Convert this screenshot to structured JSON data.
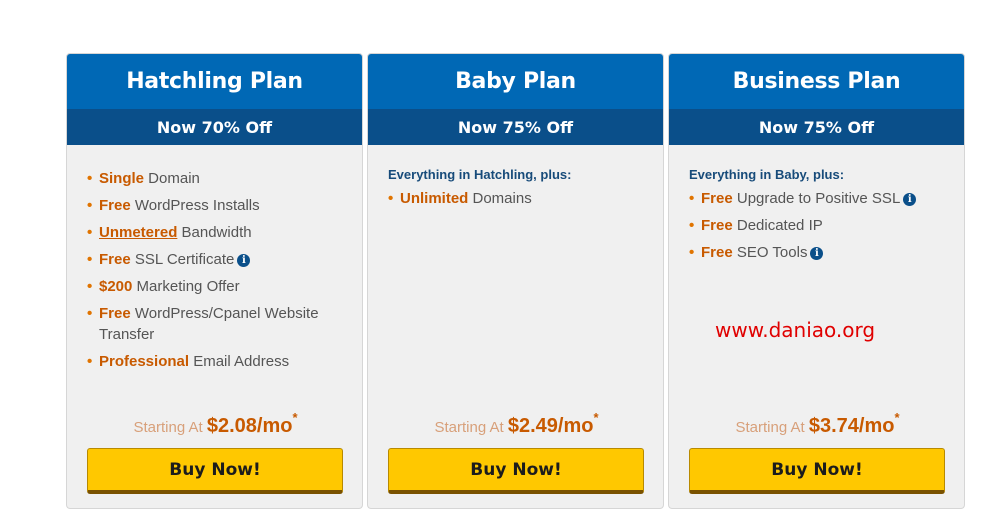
{
  "plans": [
    {
      "title": "Hatchling Plan",
      "discount": "Now 70% Off",
      "features": [
        {
          "highlight": "Single",
          "text": " Domain"
        },
        {
          "highlight": "Free",
          "text": " WordPress Installs"
        },
        {
          "highlight": "Unmetered",
          "text": " Bandwidth"
        },
        {
          "highlight": "Free",
          "text": " SSL Certificate"
        },
        {
          "highlight": "$200",
          "text": " Marketing Offer"
        },
        {
          "highlight": "Free",
          "text": " WordPress/Cpanel Website Transfer"
        },
        {
          "highlight": "Professional",
          "text": " Email Address"
        }
      ],
      "price_prefix": "Starting At ",
      "price": "$2.08/mo",
      "price_mark": "*",
      "button": "Buy Now!"
    },
    {
      "title": "Baby Plan",
      "discount": "Now 75% Off",
      "intro": "Everything in Hatchling, plus:",
      "features": [
        {
          "highlight": "Unlimited",
          "text": " Domains"
        }
      ],
      "price_prefix": "Starting At ",
      "price": "$2.49/mo",
      "price_mark": "*",
      "button": "Buy Now!"
    },
    {
      "title": "Business Plan",
      "discount": "Now 75% Off",
      "intro": "Everything in Baby, plus:",
      "features": [
        {
          "highlight": "Free",
          "text": " Upgrade to Positive SSL"
        },
        {
          "highlight": "Free",
          "text": " Dedicated IP"
        },
        {
          "highlight": "Free",
          "text": " SEO Tools"
        }
      ],
      "price_prefix": "Starting At ",
      "price": "$3.74/mo",
      "price_mark": "*",
      "button": "Buy Now!"
    }
  ],
  "info_icon_glyph": "i",
  "watermark": "www.daniao.org",
  "colors": {
    "header_blue": "#0068b5",
    "discount_blue": "#0a4f8a",
    "highlight_orange": "#c85a00",
    "button_yellow": "#ffc800",
    "watermark_red": "#e00000"
  }
}
